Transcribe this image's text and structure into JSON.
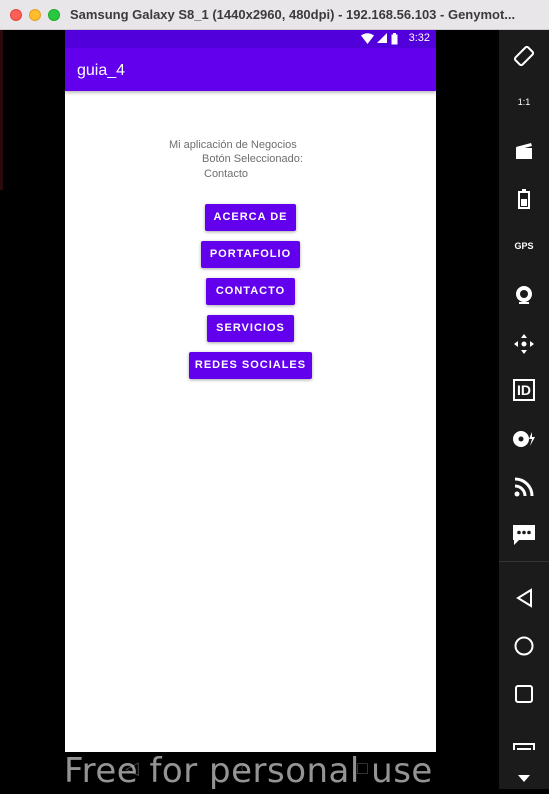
{
  "window": {
    "title": "Samsung Galaxy S8_1 (1440x2960, 480dpi) - 192.168.56.103 - Genymot..."
  },
  "status_bar": {
    "time": "3:32"
  },
  "app_bar": {
    "title": "guia_4"
  },
  "content": {
    "line1": "Mi aplicación de Negocios",
    "line2": "Botón Seleccionado:",
    "line3": "Contacto",
    "buttons": [
      {
        "label": "ACERCA DE"
      },
      {
        "label": "PORTAFOLIO"
      },
      {
        "label": "CONTACTO"
      },
      {
        "label": "SERVICIOS"
      },
      {
        "label": "REDES SOCIALES"
      }
    ]
  },
  "watermark": "Free for personal use",
  "toolbar": {
    "icons": [
      "rotate-icon",
      "pixel-perfect-icon",
      "screencast-icon",
      "battery-icon",
      "gps-icon",
      "webcam-icon",
      "dpad-icon",
      "device-id-icon",
      "disk-io-icon",
      "network-icon",
      "sms-icon",
      "back-icon",
      "home-icon",
      "recent-apps-icon",
      "menu-icon",
      "scroll-down-icon"
    ],
    "labels": {
      "pixel_perfect": "1:1",
      "gps": "GPS",
      "id": "ID"
    }
  },
  "colors": {
    "primary": "#6200ee",
    "primary_dark": "#5200db",
    "toolbar_bg": "#1b1b1b"
  }
}
